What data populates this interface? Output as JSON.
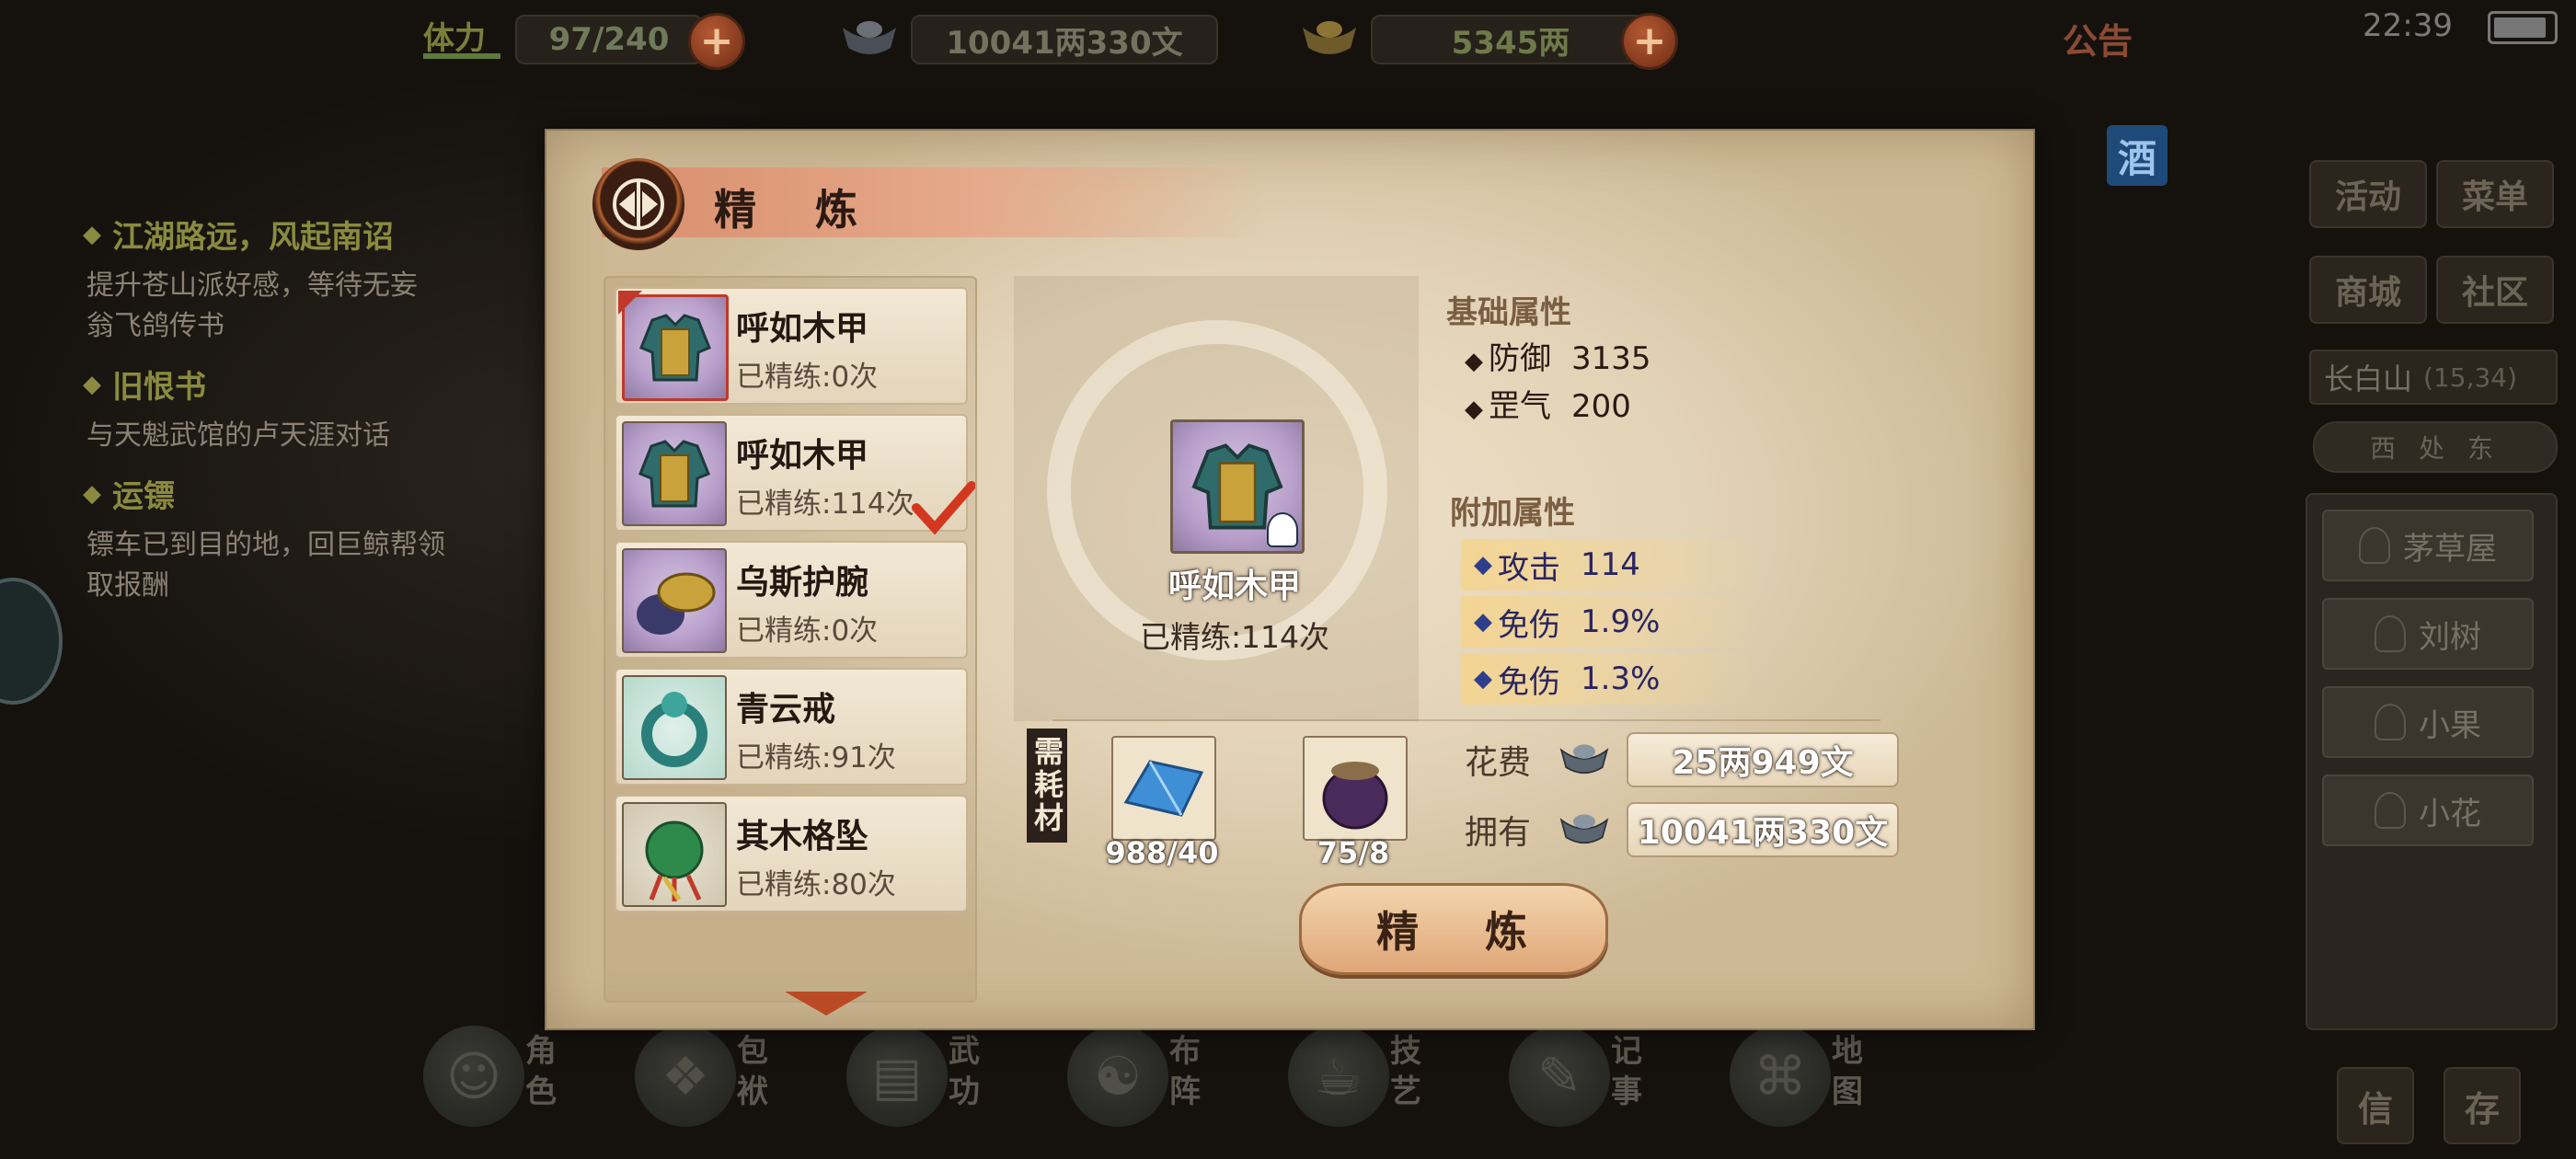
{
  "top_bar": {
    "stamina_label": "体力",
    "stamina_value": "97/240",
    "silver_value": "10041两330文",
    "gold_value": "5345两",
    "notice_label": "公告",
    "clock": "22:39"
  },
  "quest_log": [
    {
      "title": "江湖路远，风起南诏",
      "desc": "提升苍山派好感，等待无妄翁飞鸽传书"
    },
    {
      "title": "旧恨书",
      "desc": "与天魁武馆的卢天涯对话"
    },
    {
      "title": "运镖",
      "desc": "镖车已到目的地，回巨鲸帮领取报酬"
    }
  ],
  "side_menu": {
    "wine_badge": "酒",
    "buttons": [
      "活动",
      "菜单",
      "商城",
      "社区"
    ],
    "location": "长白山",
    "coords": "(15,34)",
    "direction": "西 处 东",
    "npcs": [
      "茅草屋",
      "刘树",
      "小果",
      "小花"
    ],
    "bottom_buttons": [
      "信",
      "存"
    ]
  },
  "bottom_nav": [
    "角色",
    "包袱",
    "武功",
    "布阵",
    "技艺",
    "记事",
    "地图"
  ],
  "dialog": {
    "title": "精 炼",
    "items": [
      {
        "name": "呼如木甲",
        "refined": "已精练:0次",
        "selected": true,
        "starred": true
      },
      {
        "name": "呼如木甲",
        "refined": "已精练:114次",
        "checked": true
      },
      {
        "name": "乌斯护腕",
        "refined": "已精练:0次"
      },
      {
        "name": "青云戒",
        "refined": "已精练:91次"
      },
      {
        "name": "其木格坠",
        "refined": "已精练:80次"
      }
    ],
    "detail": {
      "name": "呼如木甲",
      "refined": "已精练:114次",
      "base_head": "基础属性",
      "base_stats": [
        {
          "name": "防御",
          "value": "3135"
        },
        {
          "name": "罡气",
          "value": "200"
        }
      ],
      "extra_head": "附加属性",
      "extra_stats": [
        {
          "name": "攻击",
          "value": "114"
        },
        {
          "name": "免伤",
          "value": "1.9%"
        },
        {
          "name": "免伤",
          "value": "1.3%"
        }
      ]
    },
    "materials_label": "需耗材",
    "materials": [
      {
        "icon": "blue-cloth-icon",
        "count": "988/40"
      },
      {
        "icon": "purple-jar-icon",
        "count": "75/8"
      }
    ],
    "cost_label": "花费",
    "cost_value": "25两949文",
    "own_label": "拥有",
    "own_value": "10041两330文",
    "refine_button": "精 炼"
  },
  "colors": {
    "panel_bg": "#e2d2b6",
    "title_ribbon": "#d88d6c",
    "accent_red": "#c0392b",
    "extra_stat_highlight": "#f5d48c"
  }
}
